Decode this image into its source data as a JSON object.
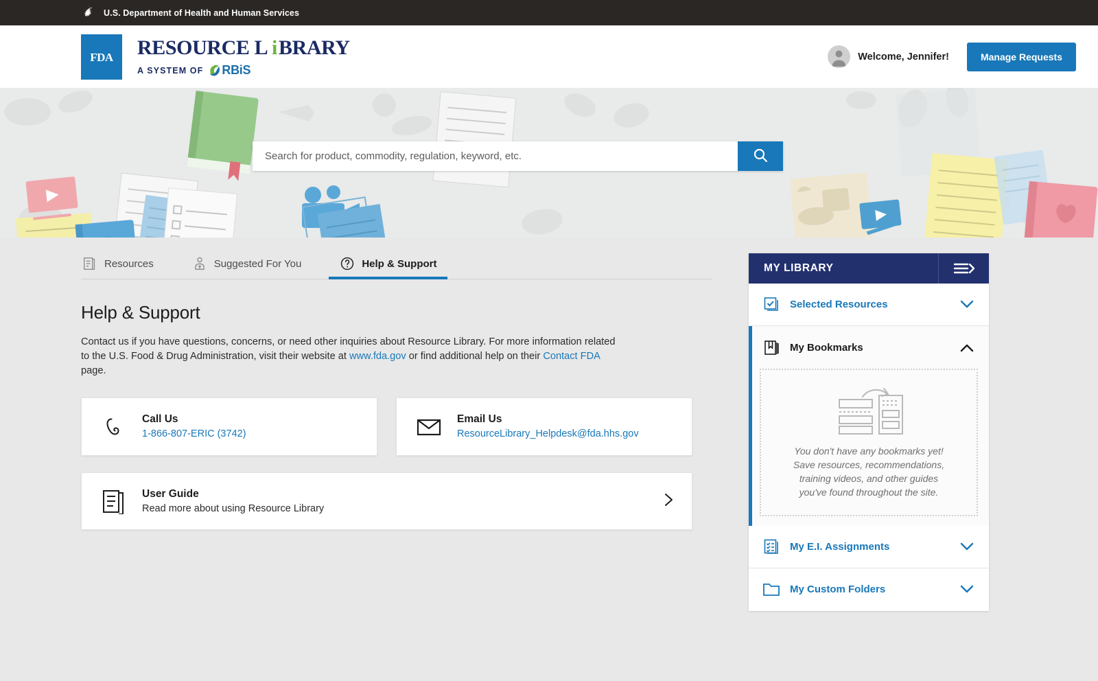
{
  "govbar": {
    "agency": "U.S. Department of Health and Human Services",
    "logo_icon": "hhs-seal-icon"
  },
  "brand": {
    "fda_mark": "FDA",
    "title": "RESOURCE LIBRARY",
    "subtitle": "A SYSTEM OF",
    "system_name": "RBiS",
    "colors": {
      "fda_blue": "#1878b9",
      "navy": "#1b2b63",
      "rbis_green": "#6cb33f"
    }
  },
  "header": {
    "welcome": "Welcome, Jennifer!",
    "avatar_icon": "user-avatar-icon",
    "manage_requests_label": "Manage Requests"
  },
  "search": {
    "placeholder": "Search for product, commodity, regulation, keyword, etc.",
    "value": "",
    "button_icon": "search-icon"
  },
  "tabs": [
    {
      "label": "Resources",
      "icon": "document-list-icon",
      "active": false
    },
    {
      "label": "Suggested For You",
      "icon": "person-suggestion-icon",
      "active": false
    },
    {
      "label": "Help & Support",
      "icon": "question-circle-icon",
      "active": true
    }
  ],
  "help": {
    "title": "Help & Support",
    "intro_part1": "Contact us if you have questions, concerns, or need other inquiries about Resource Library. For more information related to the U.S. Food & Drug Administration, visit their website at ",
    "link_fda": "www.fda.gov",
    "intro_part2": " or find additional help on their ",
    "link_contact": "Contact FDA",
    "intro_part3": " page.",
    "cards": [
      {
        "name": "call-us",
        "icon": "phone-icon",
        "title": "Call Us",
        "value": "1-866-807-ERIC (3742)"
      },
      {
        "name": "email-us",
        "icon": "envelope-icon",
        "title": "Email Us",
        "value": "ResourceLibrary_Helpdesk@fda.hhs.gov"
      }
    ],
    "user_guide": {
      "icon": "guide-document-icon",
      "title": "User Guide",
      "subtitle": "Read more about using Resource Library",
      "chevron_icon": "chevron-right-icon"
    }
  },
  "my_library": {
    "header_title": "MY LIBRARY",
    "header_button_icon": "menu-expand-icon",
    "header_color": "#22306e",
    "items": [
      {
        "label": "Selected Resources",
        "icon": "checkbox-stack-icon",
        "state": "collapsed",
        "caret": "chevron-down-icon"
      },
      {
        "label": "My Bookmarks",
        "icon": "bookmark-icon",
        "state": "expanded",
        "caret": "chevron-up-icon"
      },
      {
        "label": "My E.I. Assignments",
        "icon": "checklist-icon",
        "state": "collapsed",
        "caret": "chevron-down-icon"
      },
      {
        "label": "My Custom Folders",
        "icon": "folder-icon",
        "state": "collapsed",
        "caret": "chevron-down-icon"
      }
    ],
    "bookmarks_empty": {
      "illustration_icon": "empty-bookmarks-illustration",
      "line1": "You don't have any bookmarks yet!",
      "line2": "Save resources, recommendations,",
      "line3": "training videos, and other guides",
      "line4": "you've found throughout the site."
    }
  }
}
